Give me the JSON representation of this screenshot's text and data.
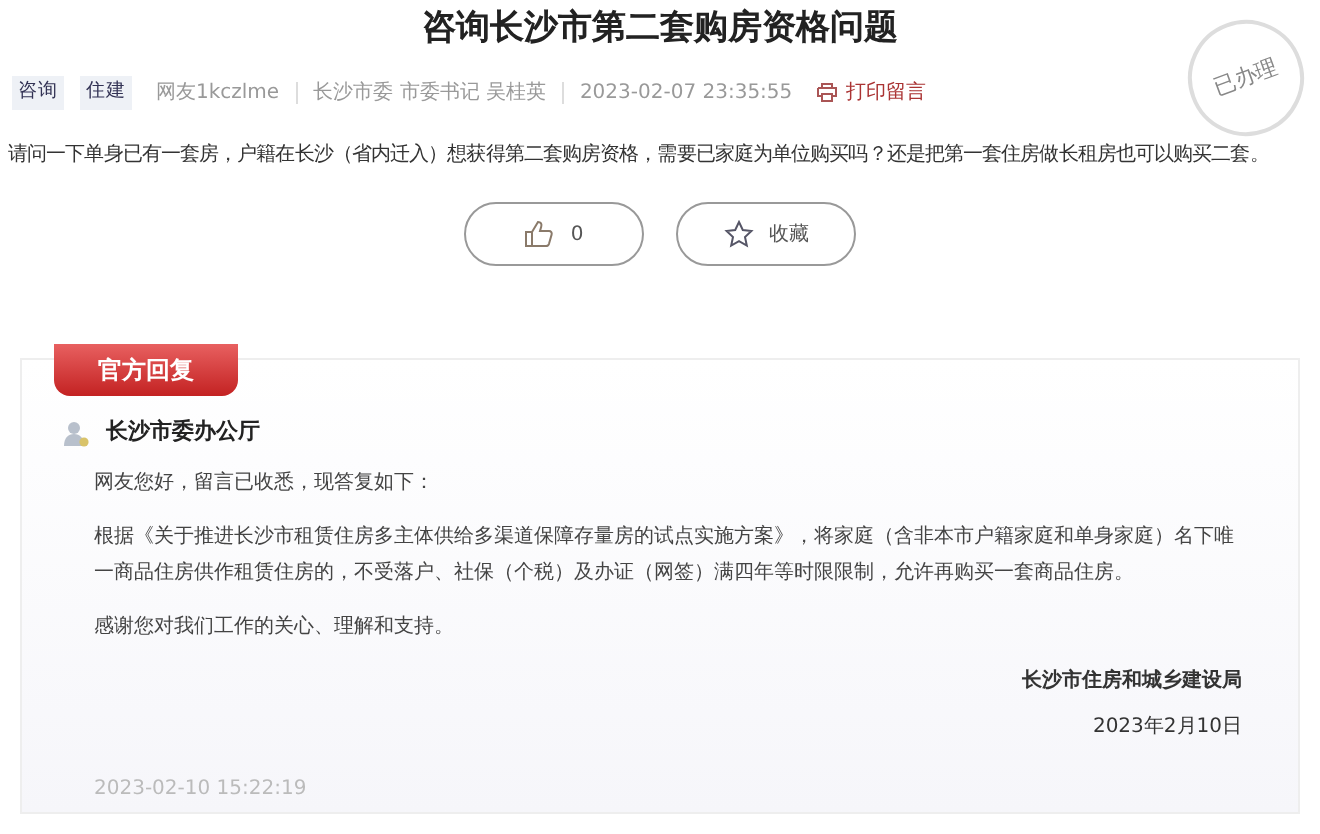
{
  "title": "咨询长沙市第二套购房资格问题",
  "meta": {
    "tags": [
      "咨询",
      "住建"
    ],
    "author": "网友1kczlme",
    "department": "长沙市委 市委书记 吴桂英",
    "datetime": "2023-02-07 23:35:55",
    "print_label": "打印留言"
  },
  "stamp": "已办理",
  "question": "请问一下单身已有一套房，户籍在长沙（省内迁入）想获得第二套购房资格，需要已家庭为单位购买吗？还是把第一套住房做长租房也可以购买二套。",
  "buttons": [
    {
      "kind": "like",
      "label": "0"
    },
    {
      "kind": "favorite",
      "label": "收藏"
    }
  ],
  "reply": {
    "ribbon": "官方回复",
    "responder": "长沙市委办公厅",
    "paragraphs": [
      "网友您好，留言已收悉，现答复如下：",
      "根据《关于推进长沙市租赁住房多主体供给多渠道保障存量房的试点实施方案》，将家庭（含非本市户籍家庭和单身家庭）名下唯一商品住房供作租赁住房的，不受落户、社保（个税）及办证（网签）满四年等时限限制，允许再购买一套商品住房。",
      "感谢您对我们工作的关心、理解和支持。"
    ],
    "signature": "长沙市住房和城乡建设局",
    "date": "2023年2月10日",
    "posted_time": "2023-02-10 15:22:19"
  }
}
